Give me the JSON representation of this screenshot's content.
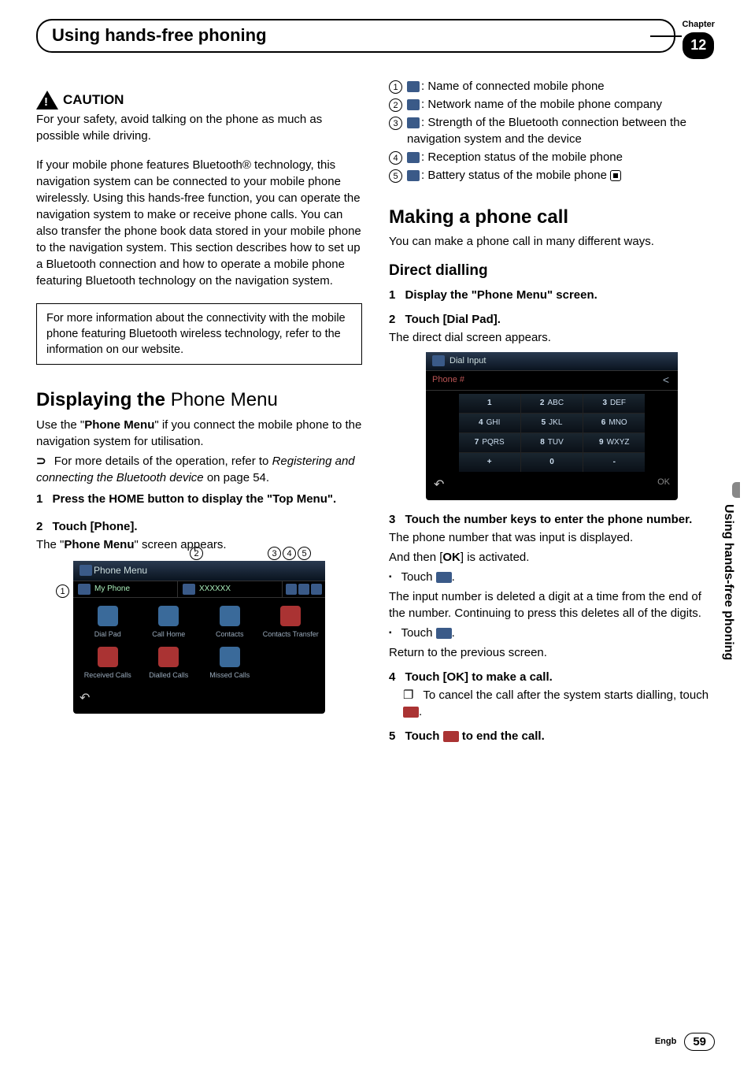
{
  "chapter": {
    "label": "Chapter",
    "number": "12",
    "title": "Using hands-free phoning"
  },
  "left": {
    "caution_label": "CAUTION",
    "caution_body": "For your safety, avoid talking on the phone as much as possible while driving.",
    "intro": "If your mobile phone features Bluetooth® technology, this navigation system can be connected to your mobile phone wirelessly. Using this hands-free function, you can operate the navigation system to make or receive phone calls. You can also transfer the phone book data stored in your mobile phone to the navigation system. This section describes how to set up a Bluetooth connection and how to operate a mobile phone featuring Bluetooth technology on the navigation system.",
    "infobox": "For more information about the connectivity with the mobile phone featuring Bluetooth wireless technology, refer to the information on our website.",
    "h2_a": "Displaying the",
    "h2_b": "Phone Menu",
    "use_pm_1": "Use the \"",
    "use_pm_bold": "Phone Menu",
    "use_pm_2": "\" if you connect the mobile phone to the navigation system for utilisation.",
    "xref_1": "For more details of the operation, refer to ",
    "xref_i": "Registering and connecting the Bluetooth device",
    "xref_2": " on page 54.",
    "step1": "Press the HOME button to display the \"Top Menu\".",
    "step2": "Touch [Phone].",
    "step2_after_1": "The \"",
    "step2_after_bold": "Phone Menu",
    "step2_after_2": "\" screen appears.",
    "phone_menu": {
      "title": "Phone Menu",
      "my_phone": "My Phone",
      "network": "XXXXXX",
      "items": [
        "Dial Pad",
        "Call Home",
        "Contacts",
        "Contacts Transfer",
        "Received Calls",
        "Dialled Calls",
        "Missed Calls"
      ]
    },
    "callout_nums": {
      "c1": "1",
      "c2": "2",
      "c3": "3",
      "c4": "4",
      "c5": "5"
    }
  },
  "right": {
    "legend": [
      ": Name of connected mobile phone",
      ": Network name of the mobile phone company",
      ": Strength of the Bluetooth connection between the navigation system and the device",
      ": Reception status of the mobile phone",
      ": Battery status of the mobile phone"
    ],
    "h2": "Making a phone call",
    "h2_body": "You can make a phone call in many different ways.",
    "h3": "Direct dialling",
    "s1": "Display the \"Phone Menu\" screen.",
    "s2": "Touch [Dial Pad].",
    "s2_after": "The direct dial screen appears.",
    "dial": {
      "title": "Dial Input",
      "phone_label": "Phone #",
      "keys": [
        {
          "n": "1",
          "l": ""
        },
        {
          "n": "2",
          "l": "ABC"
        },
        {
          "n": "3",
          "l": "DEF"
        },
        {
          "n": "4",
          "l": "GHI"
        },
        {
          "n": "5",
          "l": "JKL"
        },
        {
          "n": "6",
          "l": "MNO"
        },
        {
          "n": "7",
          "l": "PQRS"
        },
        {
          "n": "8",
          "l": "TUV"
        },
        {
          "n": "9",
          "l": "WXYZ"
        },
        {
          "n": "+",
          "l": ""
        },
        {
          "n": "0",
          "l": ""
        },
        {
          "n": "-",
          "l": ""
        }
      ],
      "ok": "OK"
    },
    "s3": "Touch the number keys to enter the phone number.",
    "s3_body1": "The phone number that was input is displayed.",
    "s3_body2a": "And then [",
    "s3_body2b": "OK",
    "s3_body2c": "] is activated.",
    "touch_back": "Touch ",
    "touch_back_after": ".",
    "back_detail": "The input number is deleted a digit at a time from the end of the number. Continuing to press this deletes all of the digits.",
    "touch_ret": "Touch ",
    "touch_ret_after": ".",
    "ret_detail": "Return to the previous screen.",
    "s4": "Touch [OK] to make a call.",
    "s4_sub_a": "To cancel the call after the system starts dialling, touch ",
    "s4_sub_b": ".",
    "s5_a": "Touch ",
    "s5_b": " to end the call."
  },
  "side_tab": "Using hands-free phoning",
  "footer": {
    "lang": "Engb",
    "page": "59"
  }
}
